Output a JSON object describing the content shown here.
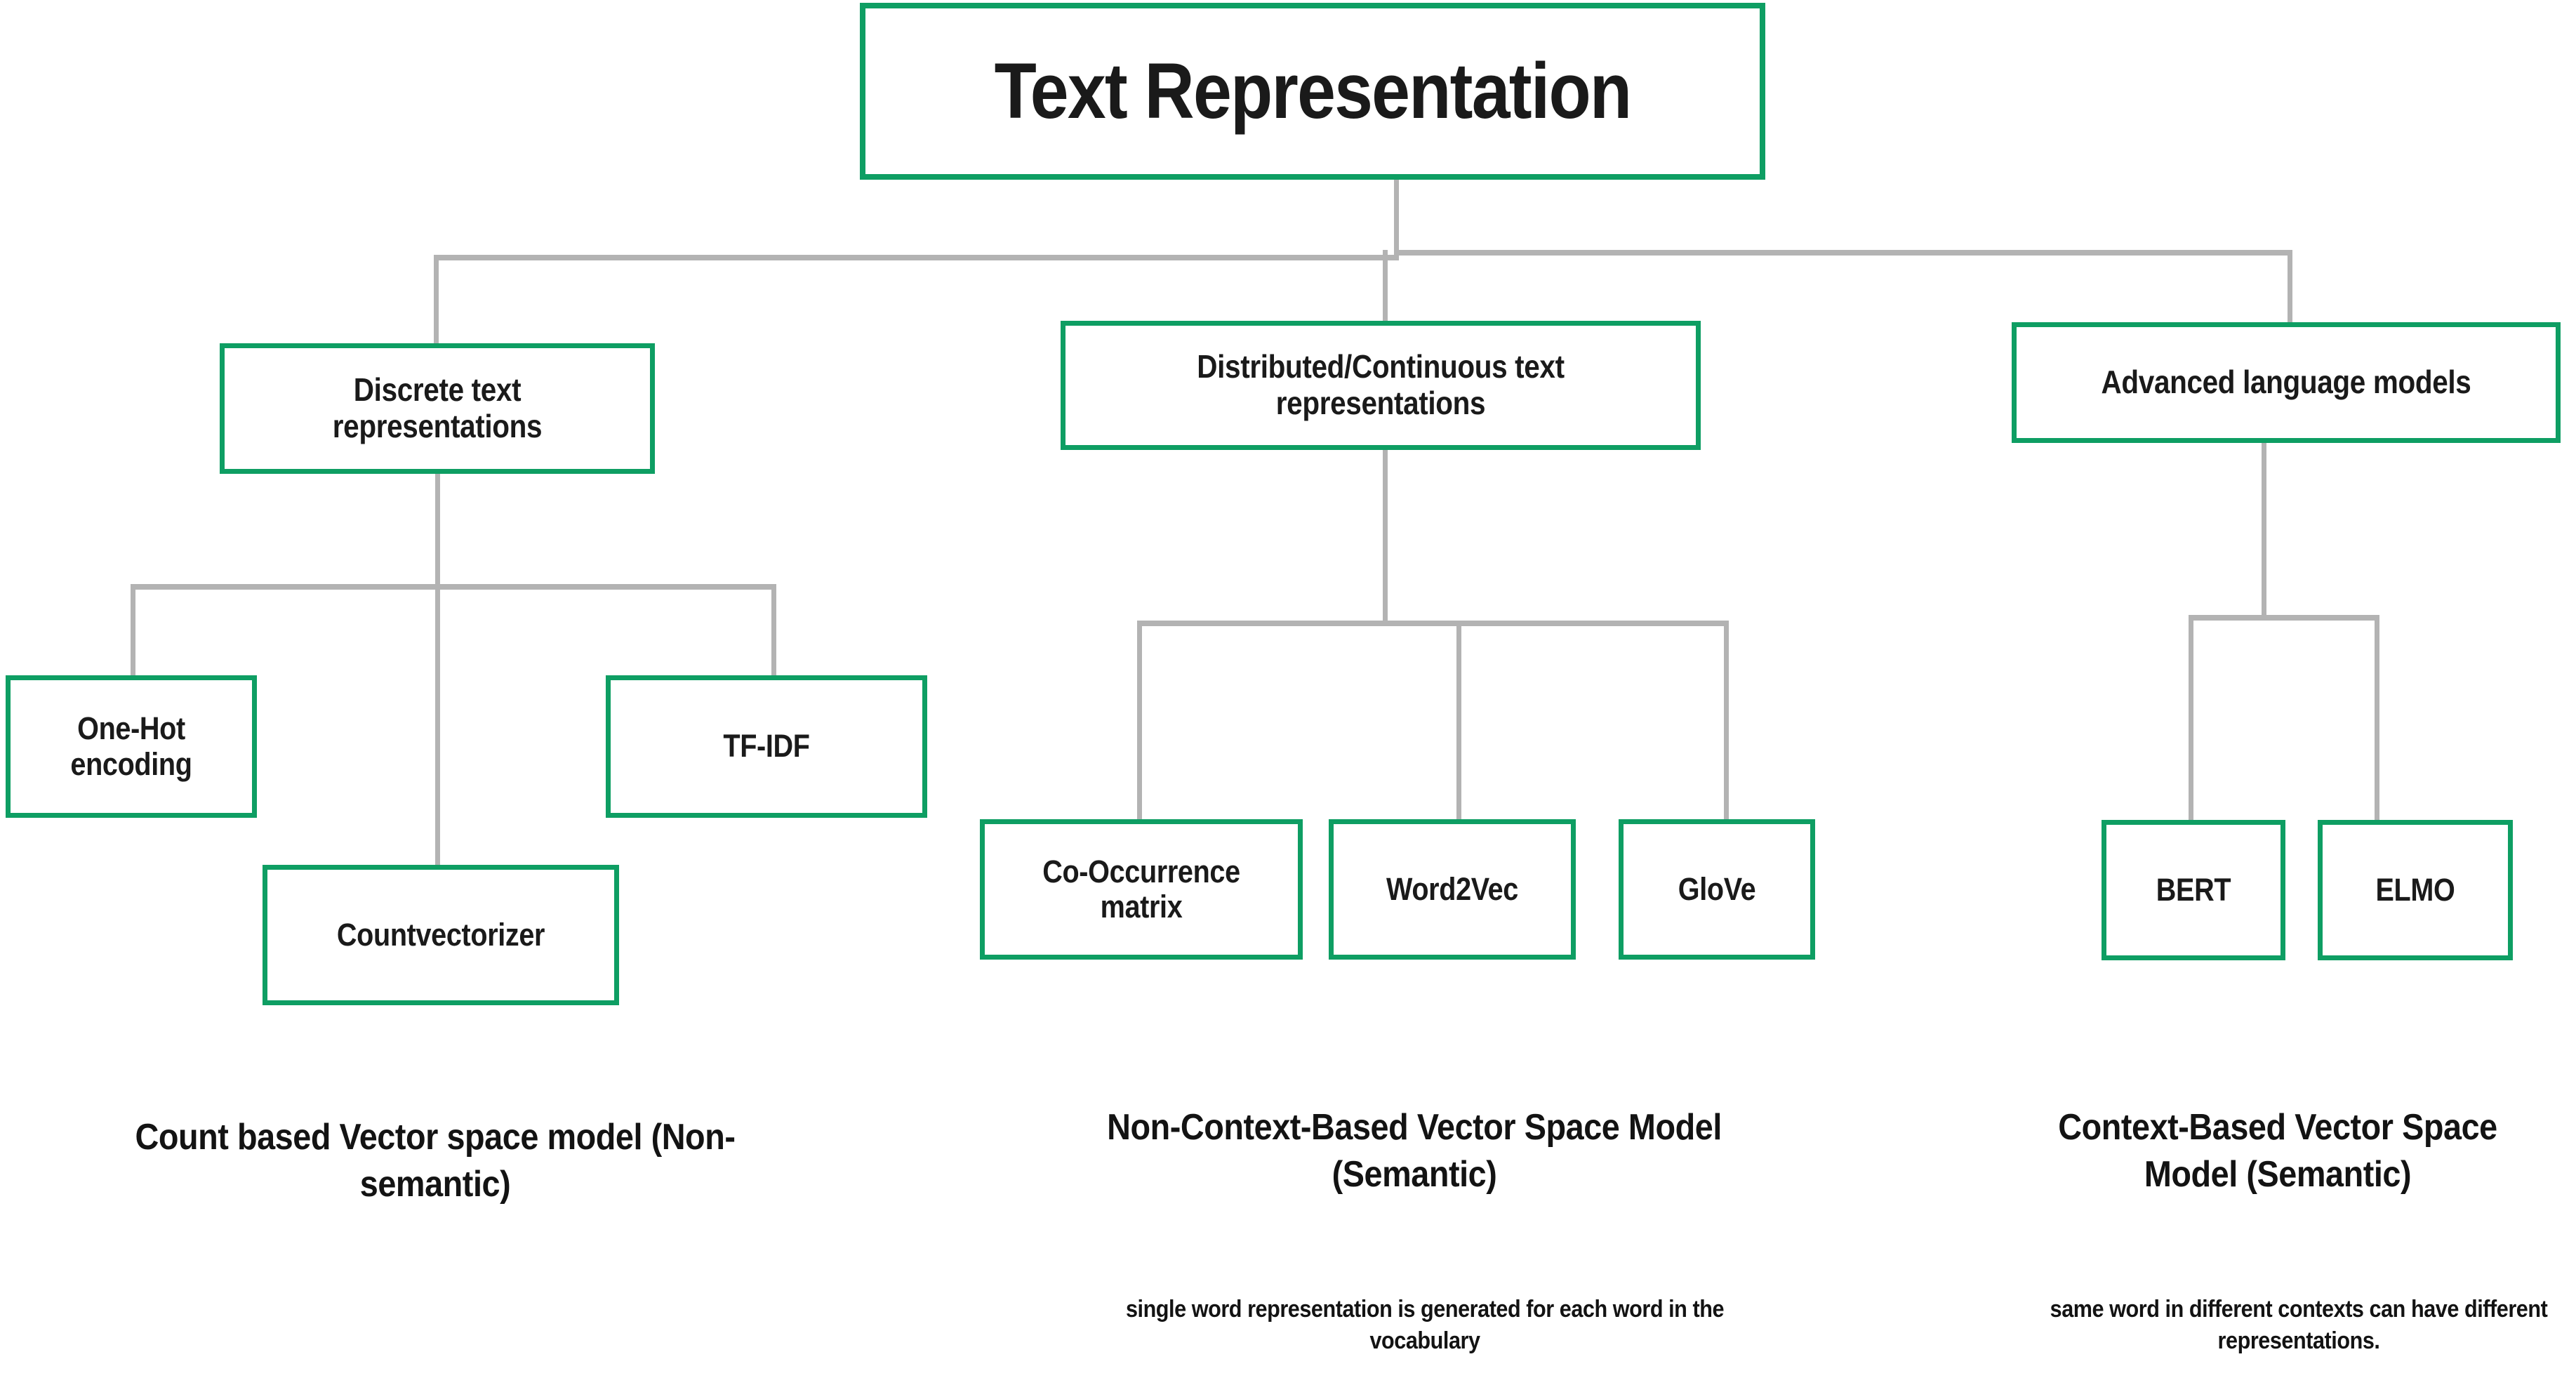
{
  "diagram": {
    "title": "Text Representation",
    "accent_color": "#0e9e63",
    "connector_color": "#b3b3b3",
    "text_color": "#1a1a1a",
    "background_color": "#ffffff"
  },
  "root": {
    "label": "Text Representation"
  },
  "branches": [
    {
      "key": "discrete",
      "label": "Discrete text representations",
      "children": [
        {
          "key": "one-hot-encoding",
          "label": "One-Hot encoding"
        },
        {
          "key": "countvectorizer",
          "label": "Countvectorizer"
        },
        {
          "key": "tf-idf",
          "label": "TF-IDF"
        }
      ],
      "caption": "Count based Vector space model (Non-semantic)",
      "subcaption": ""
    },
    {
      "key": "distributed",
      "label": "Distributed/Continuous text representations",
      "children": [
        {
          "key": "co-occurrence-matrix",
          "label": "Co-Occurrence matrix"
        },
        {
          "key": "word2vec",
          "label": "Word2Vec"
        },
        {
          "key": "glove",
          "label": "GloVe"
        }
      ],
      "caption": "Non-Context-Based Vector Space Model (Semantic)",
      "subcaption": "single word representation is generated for each word in the vocabulary"
    },
    {
      "key": "advanced",
      "label": "Advanced language models",
      "children": [
        {
          "key": "bert",
          "label": "BERT"
        },
        {
          "key": "elmo",
          "label": "ELMO"
        }
      ],
      "caption": "Context-Based Vector Space Model (Semantic)",
      "subcaption": "same word in different contexts can have different representations."
    }
  ]
}
